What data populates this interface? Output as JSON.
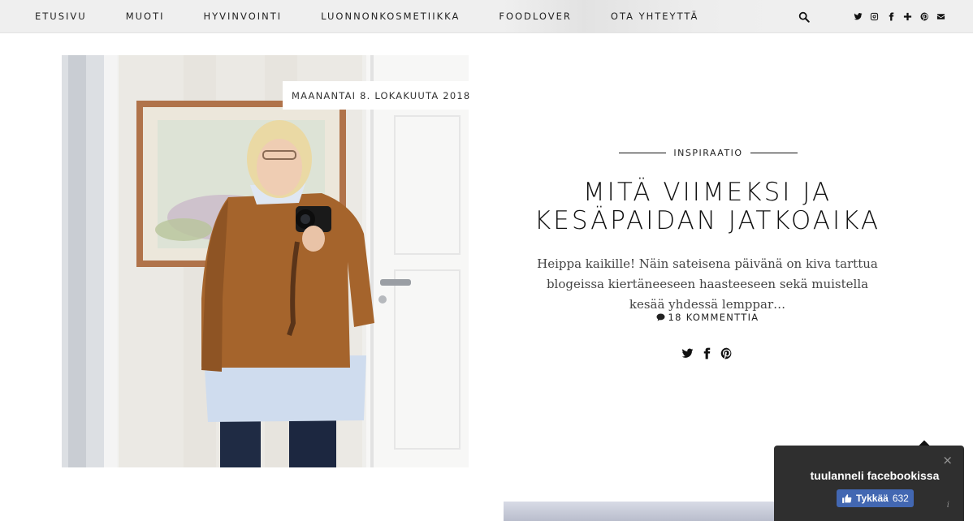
{
  "nav": {
    "items": [
      "ETUSIVU",
      "MUOTI",
      "HYVINVOINTI",
      "LUONNONKOSMETIIKKA",
      "FOODLOVER",
      "OTA YHTEYTTÄ"
    ],
    "search_icon": "search-icon",
    "social_icons": [
      "twitter-icon",
      "instagram-icon",
      "facebook-icon",
      "bloglovin-plus-icon",
      "pinterest-icon",
      "email-icon"
    ]
  },
  "post": {
    "date": "MAANANTAI 8. LOKAKUUTA 2018",
    "category": "INSPIRAATIO",
    "title": "MITÄ VIIMEKSI JA KESÄPAIDAN JATKOAIKA",
    "excerpt": "Heippa kaikille! Näin sateisena päivänä on kiva tarttua blogeissa kiertäneeseen haasteeseen sekä muistella kesää yhdessä lemppar…",
    "comments": "18 KOMMENTTIA",
    "share_icons": [
      "twitter-icon",
      "facebook-icon",
      "pinterest-icon"
    ]
  },
  "facebook_widget": {
    "title": "tuulanneli facebookissa",
    "like_label": "Tykkää",
    "like_count": "632",
    "close": "×",
    "info": "i"
  },
  "colors": {
    "nav_bg": "#efefef",
    "widget_bg": "#2f2f2f",
    "facebook_blue": "#4267b2",
    "sweater": "#a5642c"
  }
}
